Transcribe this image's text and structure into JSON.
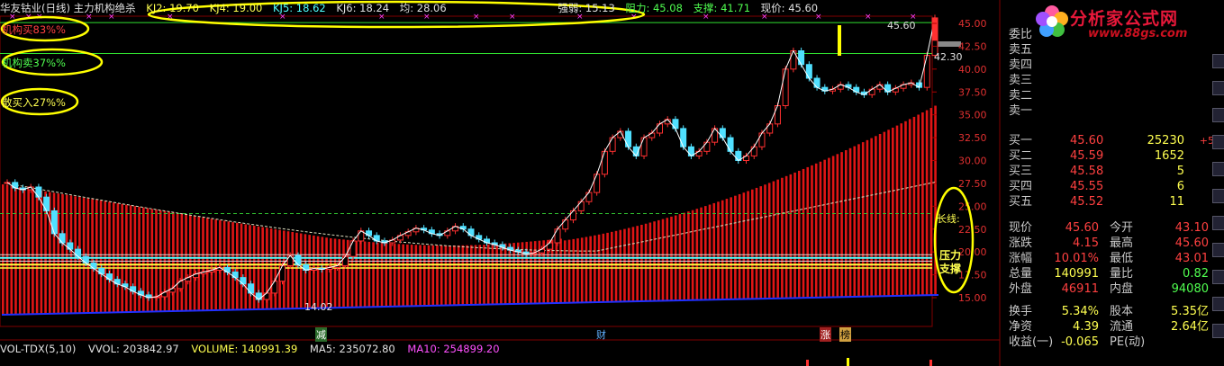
{
  "header": {
    "title": "华友钴业(日线) 主力机构绝杀",
    "kj2": "KJ2: 19.70",
    "kj4": "KJ4: 19.00",
    "kj5": "KJ5: 18.62",
    "kj6": "KJ6: 18.24",
    "avg": "均: 28.06",
    "strength": "强弱: 15.13",
    "resistance": "阻力: 45.08",
    "support": "支撑: 41.71",
    "price": "现价: 45.60"
  },
  "legend": {
    "inst_buy": "机构买83%%",
    "inst_sell": "机构卖37%%",
    "retail_buy": "散买入27%%"
  },
  "annotations": {
    "high_label": "45.60",
    "low_label": "14.02",
    "right_label": "42.30",
    "long_line": "长线:",
    "pressure": "压力",
    "support": "支撑",
    "marker_1": "减",
    "marker_2": "财",
    "marker_3": "涨",
    "marker_4": "榜"
  },
  "axis": {
    "y_ticks": [
      "45.00",
      "42.50",
      "40.00",
      "37.50",
      "35.00",
      "32.50",
      "30.00",
      "27.50",
      "25.00",
      "22.50",
      "20.00",
      "17.50",
      "15.00"
    ]
  },
  "volume_bar": {
    "name": "VOL-TDX(5,10)",
    "vvol": "VVOL: 203842.97",
    "volume": "VOLUME: 140991.39",
    "ma5": "MA5: 235072.80",
    "ma10": "MA10: 254899.20"
  },
  "order_book": {
    "wb": {
      "label": "委比"
    },
    "sells": [
      {
        "label": "卖五"
      },
      {
        "label": "卖四"
      },
      {
        "label": "卖三"
      },
      {
        "label": "卖二"
      },
      {
        "label": "卖一"
      }
    ],
    "buys": [
      {
        "label": "买一",
        "price": "45.60",
        "vol": "25230",
        "delta": "+5"
      },
      {
        "label": "买二",
        "price": "45.59",
        "vol": "1652",
        "delta": ""
      },
      {
        "label": "买三",
        "price": "45.58",
        "vol": "5",
        "delta": ""
      },
      {
        "label": "买四",
        "price": "45.55",
        "vol": "6",
        "delta": ""
      },
      {
        "label": "买五",
        "price": "45.52",
        "vol": "11",
        "delta": ""
      }
    ]
  },
  "quote": [
    {
      "l1": "现价",
      "v1": "45.60",
      "c1": "#ff4040",
      "l2": "今开",
      "v2": "43.10",
      "c2": "#ff4040"
    },
    {
      "l1": "涨跌",
      "v1": "4.15",
      "c1": "#ff4040",
      "l2": "最高",
      "v2": "45.60",
      "c2": "#ff4040"
    },
    {
      "l1": "涨幅",
      "v1": "10.01%",
      "c1": "#ff4040",
      "l2": "最低",
      "v2": "43.01",
      "c2": "#ff4040"
    },
    {
      "l1": "总量",
      "v1": "140991",
      "c1": "#ffff50",
      "l2": "量比",
      "v2": "0.82",
      "c2": "#50ff50"
    },
    {
      "l1": "外盘",
      "v1": "46911",
      "c1": "#ff4040",
      "l2": "内盘",
      "v2": "94080",
      "c2": "#50ff50"
    },
    {
      "l1": "换手",
      "v1": "5.34%",
      "c1": "#ffff50",
      "l2": "股本",
      "v2": "5.35亿",
      "c2": "#ffff50"
    },
    {
      "l1": "净资",
      "v1": "4.39",
      "c1": "#ffff50",
      "l2": "流通",
      "v2": "2.64亿",
      "c2": "#ffff50"
    },
    {
      "l1": "收益(一)",
      "v1": "-0.065",
      "c1": "#ffff50",
      "l2": "PE(动)",
      "v2": "",
      "c2": "#ffff50"
    }
  ],
  "logo": {
    "text": "分析家公式网",
    "url": "www.88gs.com"
  },
  "colors": {
    "up": "#ff3030",
    "down": "#50e0ff",
    "yellow": "#ffff00",
    "green": "#30e030"
  },
  "chart_data": {
    "type": "candlestick",
    "y_range": [
      13.5,
      46.5
    ],
    "closes": [
      27.6,
      27.0,
      26.8,
      27.1,
      26.0,
      24.5,
      22.0,
      21.0,
      20.3,
      19.5,
      18.8,
      18.2,
      17.6,
      17.0,
      16.5,
      16.2,
      15.7,
      15.3,
      15.0,
      15.1,
      15.6,
      16.0,
      16.8,
      17.2,
      17.6,
      17.8,
      18.0,
      18.3,
      17.8,
      17.2,
      16.5,
      15.5,
      14.8,
      15.5,
      16.8,
      18.5,
      19.6,
      18.6,
      18.0,
      18.2,
      18.1,
      18.3,
      18.5,
      19.5,
      21.2,
      22.3,
      21.8,
      21.2,
      21.0,
      21.3,
      21.8,
      22.2,
      22.6,
      22.4,
      22.0,
      21.8,
      22.3,
      22.8,
      22.5,
      21.8,
      21.4,
      21.0,
      20.8,
      20.5,
      20.2,
      20.0,
      19.8,
      19.9,
      20.3,
      21.0,
      22.5,
      23.5,
      24.5,
      25.5,
      26.5,
      28.5,
      31.0,
      32.5,
      33.2,
      31.5,
      30.5,
      32.5,
      33.0,
      34.0,
      34.5,
      33.5,
      31.5,
      30.5,
      31.0,
      32.0,
      33.5,
      32.5,
      31.0,
      30.0,
      30.5,
      31.5,
      33.0,
      34.0,
      36.0,
      40.0,
      42.0,
      40.5,
      39.0,
      38.0,
      37.6,
      37.8,
      38.3,
      38.0,
      37.5,
      37.2,
      37.8,
      38.3,
      37.5,
      37.9,
      38.3,
      38.5,
      38.0,
      41.5,
      45.6
    ]
  }
}
